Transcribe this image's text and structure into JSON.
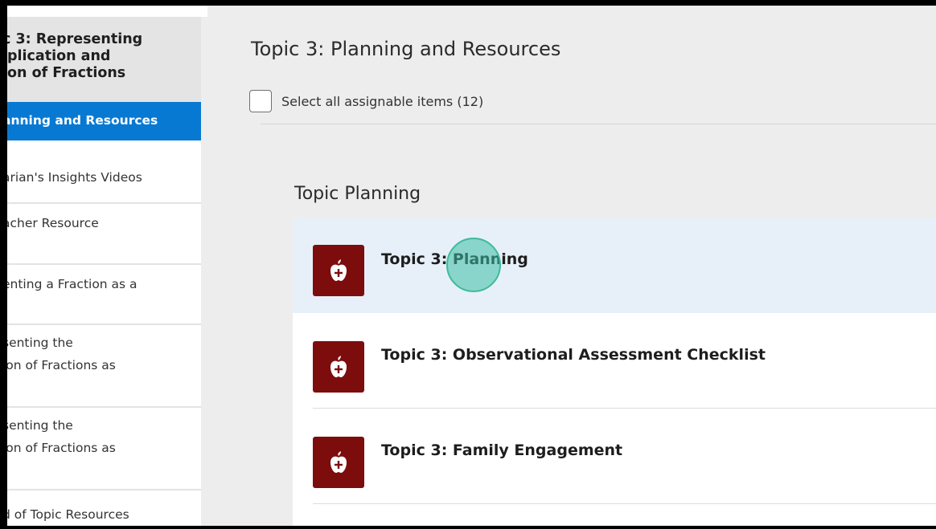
{
  "sidebar": {
    "header_lines": [
      "c 3: Representing",
      "iplication and",
      "ion of Fractions"
    ],
    "items": [
      {
        "lines": [
          "anning and Resources"
        ],
        "active": true
      },
      {
        "lines": [
          "arian's Insights Videos"
        ],
        "active": false
      },
      {
        "lines": [
          "acher Resource"
        ],
        "active": false
      },
      {
        "lines": [
          "enting a Fraction as a"
        ],
        "active": false
      },
      {
        "lines": [
          "senting the",
          "ion of Fractions as"
        ],
        "active": false
      },
      {
        "lines": [
          "senting the",
          "ion of Fractions as"
        ],
        "active": false
      },
      {
        "lines": [
          "d of Topic Resources"
        ],
        "active": false
      }
    ]
  },
  "main": {
    "title": "Topic 3: Planning and Resources",
    "select_all_label": "Select all assignable items (12)",
    "section_title": "Topic Planning",
    "items": [
      {
        "label": "Topic 3: Planning",
        "icon": "apple-plus-icon"
      },
      {
        "label": "Topic 3: Observational Assessment Checklist",
        "icon": "apple-plus-icon"
      },
      {
        "label": "Topic 3: Family Engagement",
        "icon": "apple-plus-icon"
      }
    ]
  },
  "colors": {
    "active_blue": "#0879d3",
    "icon_red": "#7d0d0d",
    "highlight_row": "#e7f0f8",
    "cursor_teal": "#3dbb9b"
  }
}
